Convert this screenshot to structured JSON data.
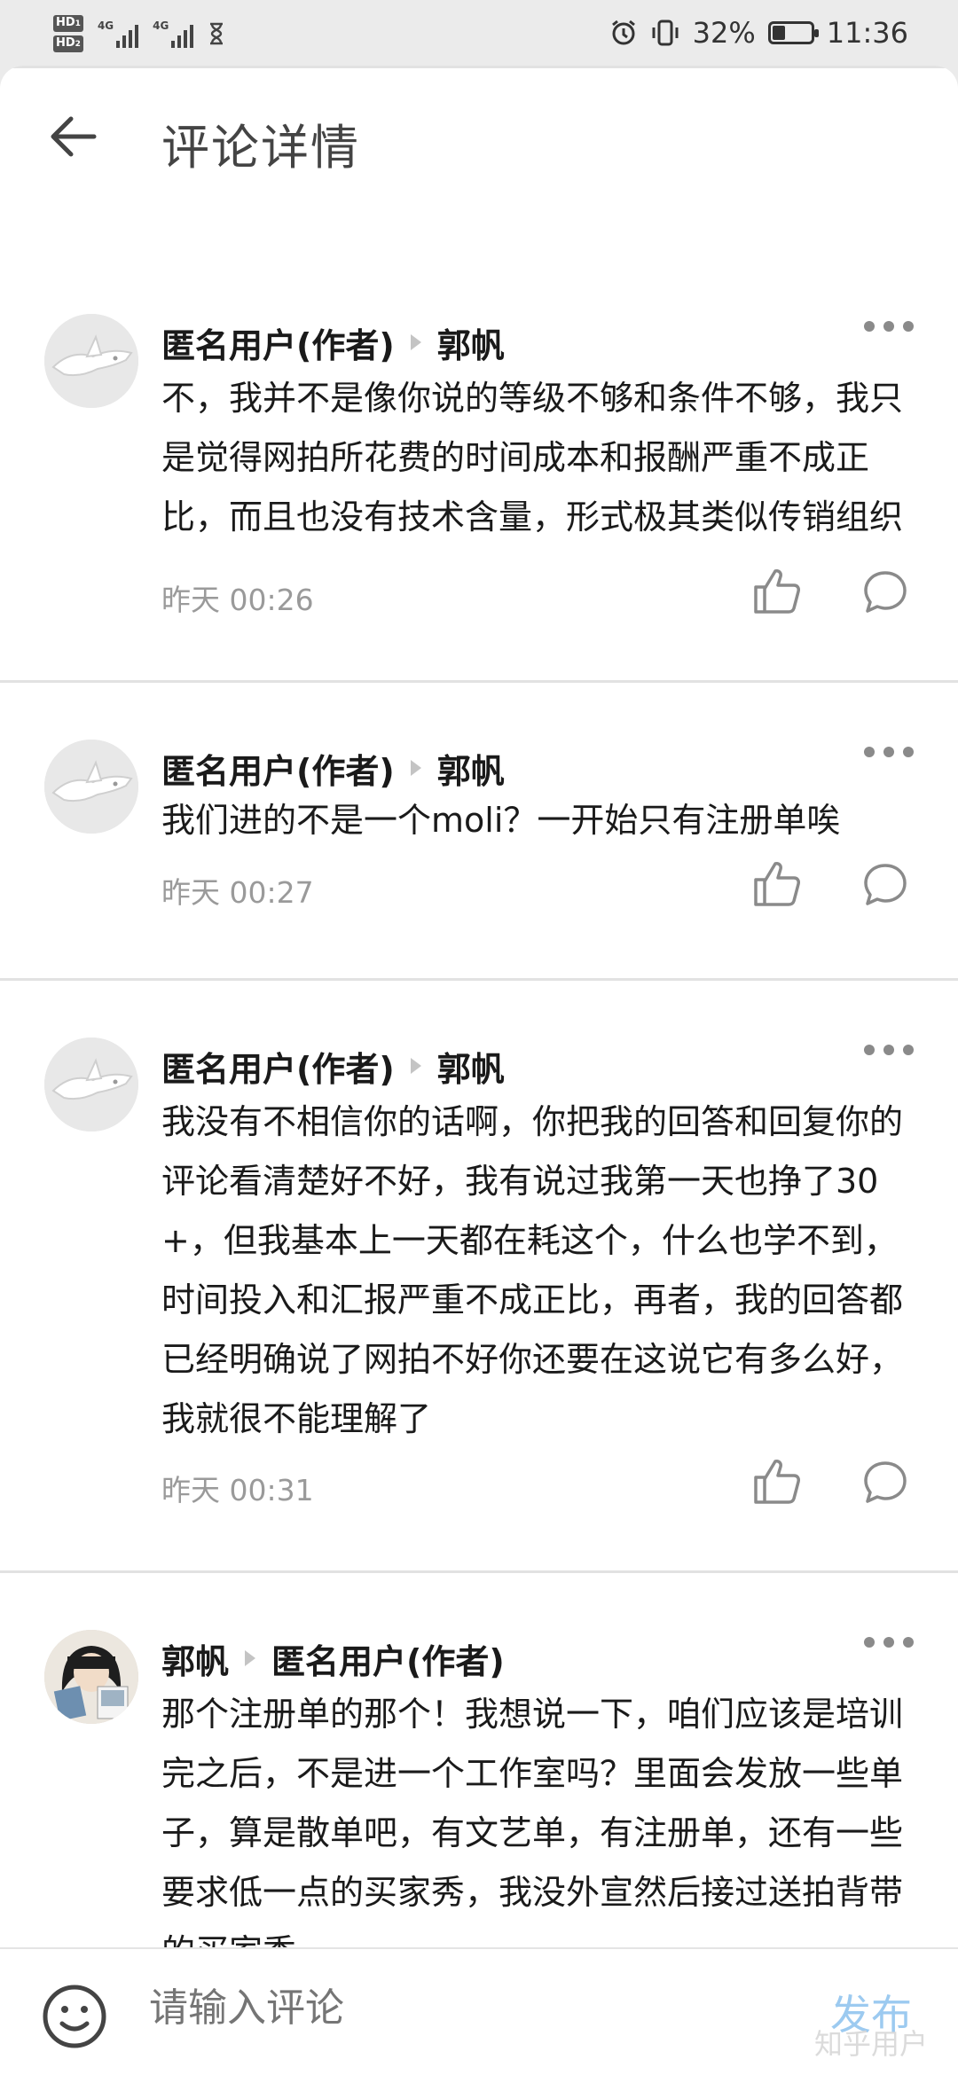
{
  "status_bar": {
    "hd1": "HD",
    "hd1_sub": "1",
    "hd2": "HD",
    "hd2_sub": "2",
    "net1": "4G",
    "net2": "4G",
    "battery_percent": "32%",
    "battery_level": 0.32,
    "time": "11:36"
  },
  "header": {
    "title": "评论详情"
  },
  "comments": [
    {
      "author": "匿名用户(作者)",
      "reply_to": "郭帆",
      "text": "不，我并不是像你说的等级不够和条件不够，我只是觉得网拍所花费的时间成本和报酬严重不成正比，而且也没有技术含量，形式极其类似传销组织",
      "time": "昨天 00:26"
    },
    {
      "author": "匿名用户(作者)",
      "reply_to": "郭帆",
      "text": "我们进的不是一个moli？一开始只有注册单唉",
      "time": "昨天 00:27"
    },
    {
      "author": "匿名用户(作者)",
      "reply_to": "郭帆",
      "text": "我没有不相信你的话啊，你把我的回答和回复你的评论看清楚好不好，我有说过我第一天也挣了30+，但我基本上一天都在耗这个，什么也学不到，时间投入和汇报严重不成正比，再者，我的回答都已经明确说了网拍不好你还要在这说它有多么好，我就很不能理解了",
      "time": "昨天 00:31"
    },
    {
      "author": "郭帆",
      "reply_to": "匿名用户(作者)",
      "text": "那个注册单的那个！我想说一下，咱们应该是培训完之后，不是进一个工作室吗？里面会发放一些单子，算是散单吧，有文艺单，有注册单，还有一些要求低一点的买家秀，我没外宣然后接过送拍背带的买家秀",
      "time": ""
    }
  ],
  "composer": {
    "placeholder": "请输入评论",
    "publish_label": "发布",
    "watermark": "知乎用户"
  },
  "colors": {
    "accent_publish": "#9ccaf0",
    "muted_text": "#9a9a9a"
  }
}
